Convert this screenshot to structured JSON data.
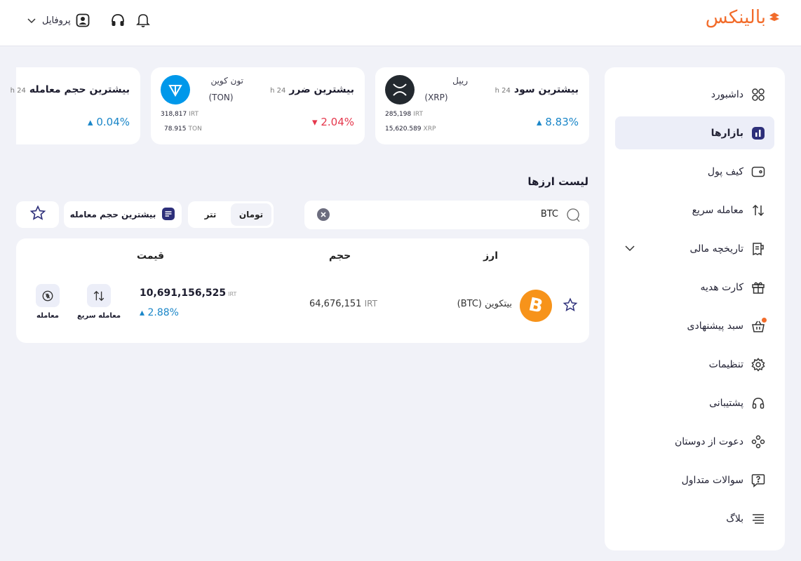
{
  "header": {
    "logo_text": "بالینکس",
    "profile_label": "پروفایل",
    "brand_color": "#f26c2b"
  },
  "sidebar": {
    "items": [
      {
        "label": "داشبورد",
        "icon": "dashboard-icon"
      },
      {
        "label": "بازارها",
        "icon": "markets-icon",
        "active": true
      },
      {
        "label": "کیف پول",
        "icon": "wallet-icon"
      },
      {
        "label": "معامله سریع",
        "icon": "swap-arrows-icon"
      },
      {
        "label": "تاریخچه مالی",
        "icon": "receipt-icon",
        "expandable": true
      },
      {
        "label": "کارت هدیه",
        "icon": "gift-icon"
      },
      {
        "label": "سبد پیشنهادی",
        "icon": "basket-icon",
        "badge_dot": true
      },
      {
        "label": "تنظیمات",
        "icon": "gear-icon"
      },
      {
        "label": "پشتیبانی",
        "icon": "headset-icon"
      },
      {
        "label": "دعوت از دوستان",
        "icon": "invite-icon"
      },
      {
        "label": "سوالات متداول",
        "icon": "question-icon"
      },
      {
        "label": "بلاگ",
        "icon": "blog-lines-icon"
      }
    ]
  },
  "cards": {
    "gainer": {
      "title": "بیشترین سود",
      "period": "24 h",
      "change": "8.83%",
      "coin_name": "ریپل",
      "coin_symbol": "(XRP)",
      "price_irt": "285,198",
      "irt_unit": "IRT",
      "volume": "15,620.589",
      "volume_unit": "XRP"
    },
    "loser": {
      "title": "بیشترین ضرر",
      "period": "24 h",
      "change": "2.04%",
      "coin_name": "تون کوین",
      "coin_symbol": "(TON)",
      "price_irt": "318,817",
      "irt_unit": "IRT",
      "volume": "78.915",
      "volume_unit": "TON"
    },
    "volume": {
      "title": "بیشترین حجم معامله",
      "period": "24 h",
      "change": "0.04%"
    }
  },
  "list": {
    "title": "لیست ارزها",
    "search_value": "BTC",
    "seg_toman": "تومان",
    "seg_tether": "تتر",
    "sort_label": "بیشترین حجم معامله"
  },
  "table": {
    "headers": {
      "coin": "ارز",
      "volume": "حجم",
      "price": "قیمت"
    },
    "rows": [
      {
        "name": "بیتکوین (BTC)",
        "volume": "64,676,151",
        "volume_unit": "IRT",
        "price": "10,691,156,525",
        "price_unit": "IRT",
        "change": "2.88%",
        "quick_trade_label": "معامله سریع",
        "trade_label": "معامله"
      }
    ]
  },
  "colors": {
    "up": "#1a86c8",
    "down": "#e5374c",
    "active_bg": "#eceef8",
    "bitcoin": "#f7931a",
    "ton": "#0098ea",
    "xrp": "#23292f"
  }
}
